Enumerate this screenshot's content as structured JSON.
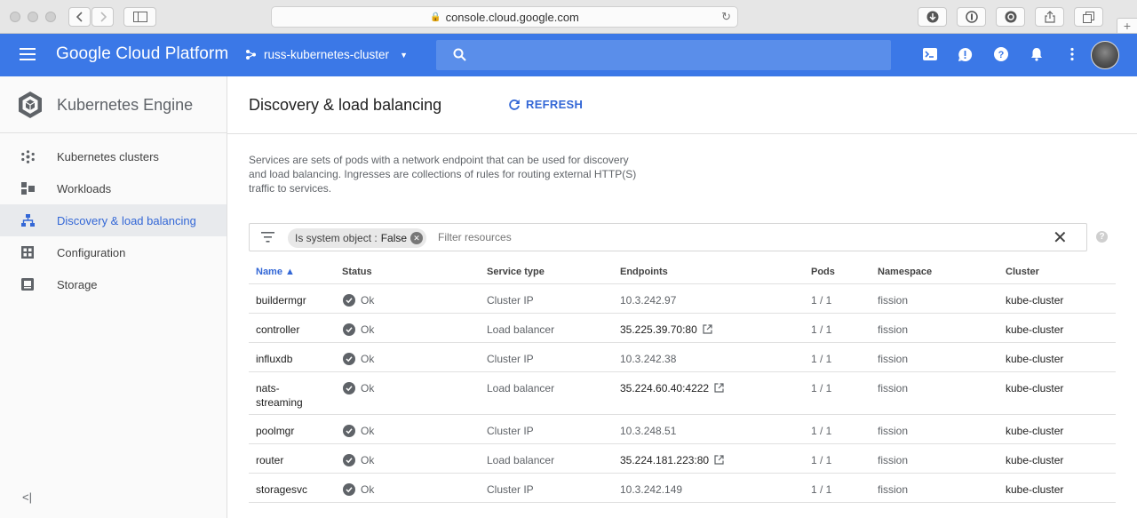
{
  "browser": {
    "url": "console.cloud.google.com"
  },
  "header": {
    "brand": "Google Cloud Platform",
    "project": "russ-kubernetes-cluster",
    "accent": "#3b78e7"
  },
  "sidebar": {
    "title": "Kubernetes Engine",
    "items": [
      {
        "label": "Kubernetes clusters",
        "icon": "clusters-icon"
      },
      {
        "label": "Workloads",
        "icon": "workloads-icon"
      },
      {
        "label": "Discovery & load balancing",
        "icon": "discovery-icon",
        "active": true
      },
      {
        "label": "Configuration",
        "icon": "configuration-icon"
      },
      {
        "label": "Storage",
        "icon": "storage-icon"
      }
    ],
    "collapse": "<|"
  },
  "main": {
    "title": "Discovery & load balancing",
    "refresh": "REFRESH",
    "description": "Services are sets of pods with a network endpoint that can be used for discovery and load balancing. Ingresses are collections of rules for routing external HTTP(S) traffic to services.",
    "filter": {
      "chip_key": "Is system object :",
      "chip_value": "False",
      "placeholder": "Filter resources"
    }
  },
  "table": {
    "columns": [
      "Name",
      "Status",
      "Service type",
      "Endpoints",
      "Pods",
      "Namespace",
      "Cluster"
    ],
    "rows": [
      {
        "name": "buildermgr",
        "status": "Ok",
        "type": "Cluster IP",
        "endpoint": "10.3.242.97",
        "pods": "1 / 1",
        "namespace": "fission",
        "cluster": "kube-cluster"
      },
      {
        "name": "controller",
        "status": "Ok",
        "type": "Load balancer",
        "endpoint": "35.225.39.70:80",
        "pods": "1 / 1",
        "namespace": "fission",
        "cluster": "kube-cluster"
      },
      {
        "name": "influxdb",
        "status": "Ok",
        "type": "Cluster IP",
        "endpoint": "10.3.242.38",
        "pods": "1 / 1",
        "namespace": "fission",
        "cluster": "kube-cluster"
      },
      {
        "name": "nats-",
        "name2": "streaming",
        "status": "Ok",
        "type": "Load balancer",
        "endpoint": "35.224.60.40:4222",
        "pods": "1 / 1",
        "namespace": "fission",
        "cluster": "kube-cluster"
      },
      {
        "name": "poolmgr",
        "status": "Ok",
        "type": "Cluster IP",
        "endpoint": "10.3.248.51",
        "pods": "1 / 1",
        "namespace": "fission",
        "cluster": "kube-cluster"
      },
      {
        "name": "router",
        "status": "Ok",
        "type": "Load balancer",
        "endpoint": "35.224.181.223:80",
        "pods": "1 / 1",
        "namespace": "fission",
        "cluster": "kube-cluster"
      },
      {
        "name": "storagesvc",
        "status": "Ok",
        "type": "Cluster IP",
        "endpoint": "10.3.242.149",
        "pods": "1 / 1",
        "namespace": "fission",
        "cluster": "kube-cluster"
      }
    ]
  }
}
